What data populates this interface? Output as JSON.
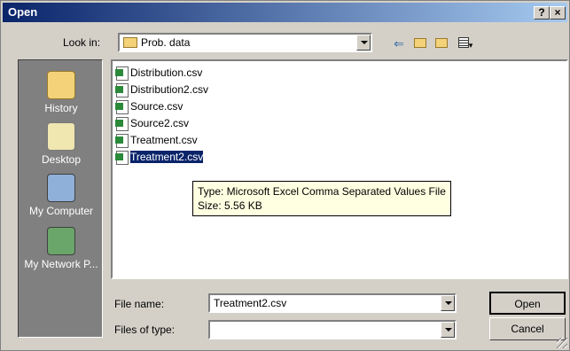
{
  "window": {
    "title": "Open",
    "help_label": "?",
    "close_label": "×"
  },
  "lookin": {
    "label": "Look in:",
    "value": "Prob. data"
  },
  "places": [
    {
      "label": "History",
      "icon": "history-icon"
    },
    {
      "label": "Desktop",
      "icon": "desktop-icon"
    },
    {
      "label": "My Computer",
      "icon": "computer-icon"
    },
    {
      "label": "My Network P...",
      "icon": "network-icon"
    }
  ],
  "files": [
    {
      "name": "Distribution.csv",
      "selected": false
    },
    {
      "name": "Distribution2.csv",
      "selected": false
    },
    {
      "name": "Source.csv",
      "selected": false
    },
    {
      "name": "Source2.csv",
      "selected": false
    },
    {
      "name": "Treatment.csv",
      "selected": false
    },
    {
      "name": "Treatment2.csv",
      "selected": true
    }
  ],
  "tooltip": {
    "type_line": "Type: Microsoft Excel Comma Separated Values File",
    "size_line": "Size: 5.56 KB"
  },
  "filename": {
    "label": "File name:",
    "value": "Treatment2.csv"
  },
  "filetype": {
    "label": "Files of type:",
    "value": ""
  },
  "buttons": {
    "open": "Open",
    "cancel": "Cancel"
  },
  "colors": {
    "title_start": "#0a246a",
    "title_end": "#a6caf0",
    "selection": "#0a246a",
    "tooltip_bg": "#ffffe1"
  }
}
